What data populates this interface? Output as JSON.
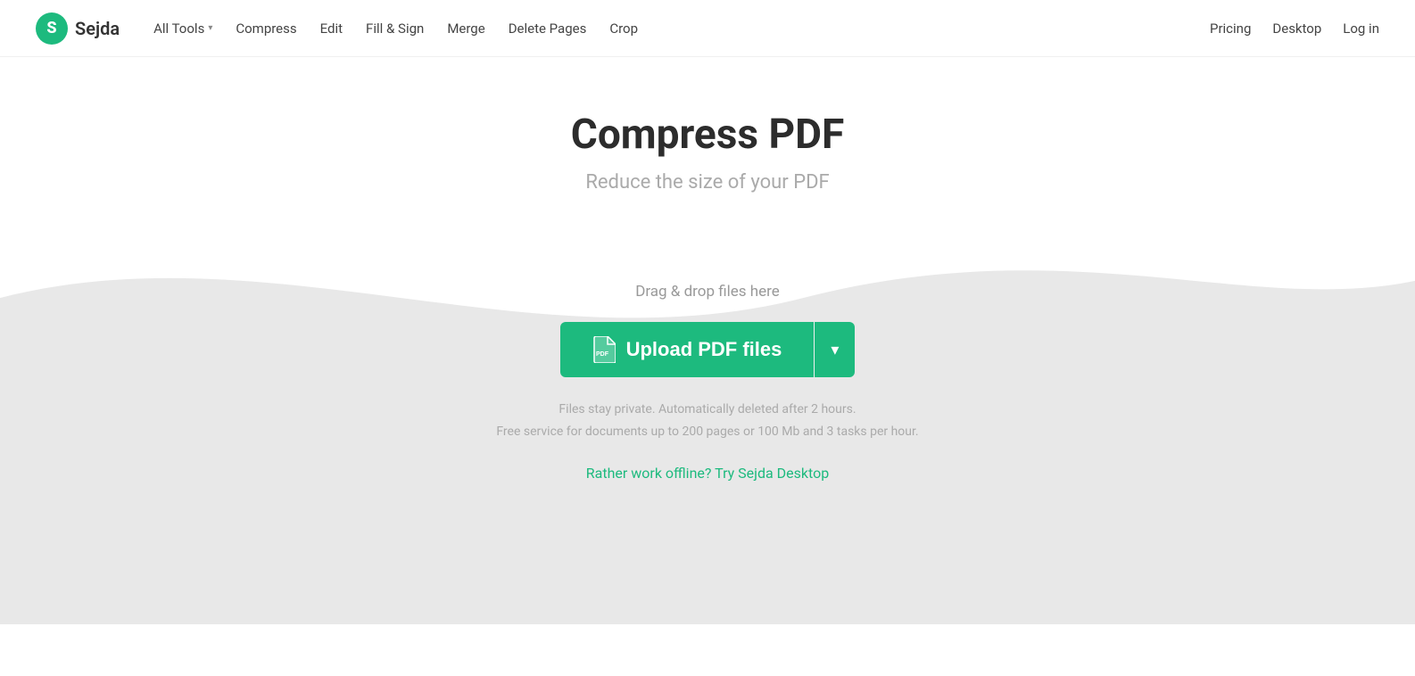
{
  "logo": {
    "letter": "S",
    "name": "Sejda"
  },
  "nav": {
    "all_tools": "All Tools",
    "compress": "Compress",
    "edit": "Edit",
    "fill_sign": "Fill & Sign",
    "merge": "Merge",
    "delete_pages": "Delete Pages",
    "crop": "Crop"
  },
  "nav_right": {
    "pricing": "Pricing",
    "desktop": "Desktop",
    "login": "Log in"
  },
  "hero": {
    "title": "Compress PDF",
    "subtitle": "Reduce the size of your PDF"
  },
  "upload": {
    "drag_drop": "Drag & drop files here",
    "button_label": "Upload PDF files",
    "privacy_line1": "Files stay private. Automatically deleted after 2 hours.",
    "privacy_line2": "Free service for documents up to 200 pages or 100 Mb and 3 tasks per hour.",
    "offline_text": "Rather work offline? Try Sejda Desktop"
  },
  "colors": {
    "brand_green": "#1dba7e",
    "text_dark": "#2c2c2c",
    "text_gray": "#aaa",
    "bg_wave": "#ebebeb"
  }
}
